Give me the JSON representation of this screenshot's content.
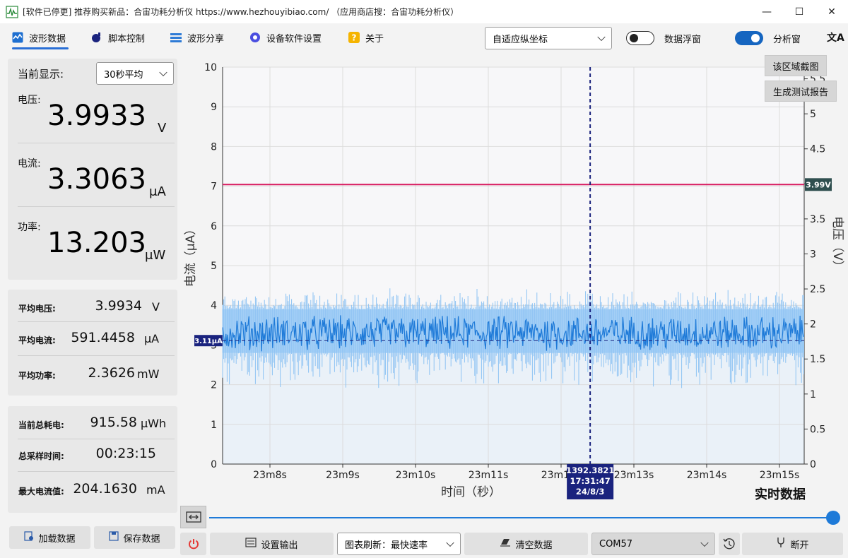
{
  "window": {
    "title": "[软件已停更] 推荐购买新品：合宙功耗分析仪 https://www.hezhouyibiao.com/ （应用商店搜：合宙功耗分析仪）"
  },
  "nav": {
    "items": [
      {
        "label": "波形数据",
        "icon": "waveform-icon"
      },
      {
        "label": "脚本控制",
        "icon": "script-icon"
      },
      {
        "label": "波形分享",
        "icon": "share-icon"
      },
      {
        "label": "设备软件设置",
        "icon": "gear-icon"
      },
      {
        "label": "关于",
        "icon": "question-icon"
      }
    ],
    "axis_mode": "自适应纵坐标",
    "float_window_label": "数据浮窗",
    "float_window_on": false,
    "analysis_label": "分析窗",
    "analysis_on": true,
    "lang_glyph": "文A"
  },
  "current_display": {
    "label": "当前显示:",
    "mode": "30秒平均"
  },
  "measurements": {
    "voltage": {
      "label": "电压:",
      "value": "3.9933",
      "unit": "V"
    },
    "current": {
      "label": "电流:",
      "value": "3.3063",
      "unit": "μA"
    },
    "power": {
      "label": "功率:",
      "value": "13.203",
      "unit": "μW"
    }
  },
  "averages": {
    "voltage": {
      "label": "平均电压:",
      "value": "3.9934",
      "unit": "V"
    },
    "current": {
      "label": "平均电流:",
      "value": "591.4458",
      "unit": "μA"
    },
    "power": {
      "label": "平均功率:",
      "value": "2.3626",
      "unit": "mW"
    }
  },
  "totals": {
    "energy": {
      "label": "当前总耗电:",
      "value": "915.58",
      "unit": "μWh"
    },
    "time": {
      "label": "总采样时间:",
      "value": "00:23:15",
      "unit": ""
    },
    "max_current": {
      "label": "最大电流值:",
      "value": "204.1630",
      "unit": "mA"
    }
  },
  "sidebar_buttons": {
    "load": "加载数据",
    "save": "保存数据"
  },
  "chart_overlay": {
    "screenshot": "该区域截图",
    "report": "生成测试报告",
    "realtime": "实时数据"
  },
  "chart_data": {
    "type": "line",
    "xlabel": "时间（秒）",
    "ylabel": "电流（μA）",
    "y2label": "电压（V）",
    "ylim": [
      0,
      10
    ],
    "y2lim": [
      0,
      5.667
    ],
    "yticks": [
      "0",
      "1",
      "2",
      "3",
      "4",
      "5",
      "6",
      "7",
      "8",
      "9",
      "10"
    ],
    "y2ticks": [
      "0",
      "0.5",
      "1",
      "1.5",
      "2",
      "2.5",
      "3",
      "3.5",
      "4",
      "4.5",
      "5",
      "5.5"
    ],
    "x_ticks": [
      "23m8s",
      "23m9s",
      "23m10s",
      "23m11s",
      "23m12s",
      "23m13s",
      "23m14s",
      "23m15s"
    ],
    "series": [
      {
        "name": "电压",
        "axis": "right",
        "value": 3.99,
        "color": "#d81b60"
      },
      {
        "name": "电流",
        "axis": "left",
        "mean": 3.3,
        "band": [
          2.8,
          3.9
        ],
        "spike_range": [
          1.9,
          4.4
        ],
        "color": "#1e7ad8"
      }
    ],
    "voltage_marker": "3.99V",
    "current_marker": "3.11μA",
    "current_marker_value": 3.11,
    "cursor": {
      "value": "1392.3821",
      "time": "17:31:47",
      "date": "24/8/3",
      "x_fraction": 0.632
    },
    "grid": true
  },
  "bottom": {
    "output_settings": "设置输出",
    "refresh": "图表刷新：最快速率",
    "clear": "清空数据",
    "port": "COM57",
    "disconnect": "断开"
  },
  "colors": {
    "accent": "#1565c0",
    "voltage": "#d81b60",
    "current": "#1e7ad8",
    "cursor_bg": "#1a237e"
  }
}
